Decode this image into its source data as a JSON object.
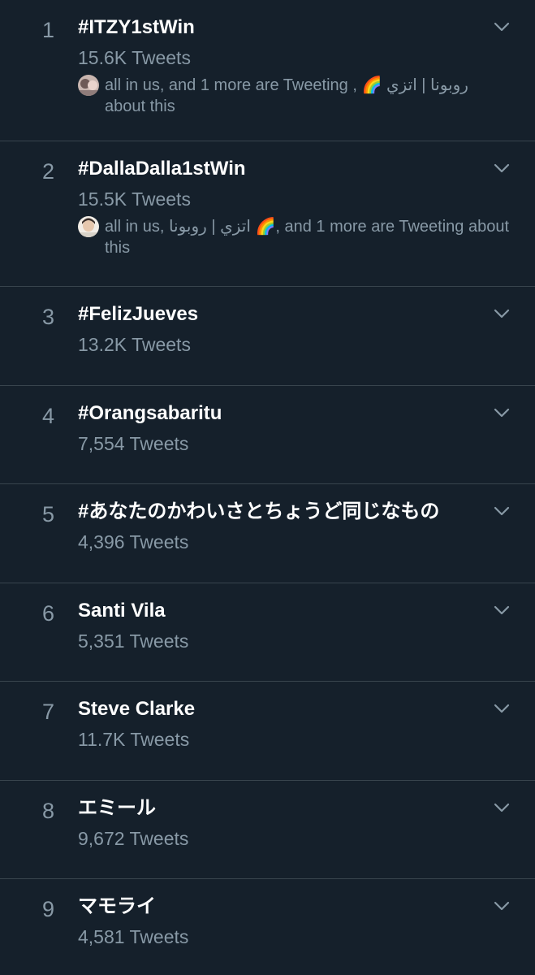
{
  "trends": [
    {
      "rank": "1",
      "title": "#ITZY1stWin",
      "count": "15.6K Tweets",
      "context": "all in us, and 1 more are Tweeting , 🌈 روبونا | اتزي about this"
    },
    {
      "rank": "2",
      "title": "#DallaDalla1stWin",
      "count": "15.5K Tweets",
      "context": "all in us, اتزي | روبونا 🌈, and 1 more are Tweeting about this"
    },
    {
      "rank": "3",
      "title": "#FelizJueves",
      "count": "13.2K Tweets"
    },
    {
      "rank": "4",
      "title": "#Orangsabaritu",
      "count": "7,554 Tweets"
    },
    {
      "rank": "5",
      "title": "#あなたのかわいさとちょうど同じなもの",
      "count": "4,396 Tweets"
    },
    {
      "rank": "6",
      "title": "Santi Vila",
      "count": "5,351 Tweets"
    },
    {
      "rank": "7",
      "title": "Steve Clarke",
      "count": "11.7K Tweets"
    },
    {
      "rank": "8",
      "title": "エミール",
      "count": "9,672 Tweets"
    },
    {
      "rank": "9",
      "title": "マモライ",
      "count": "4,581 Tweets"
    }
  ],
  "icons": {
    "chevron": "chevron-down-icon",
    "avatar": "user-avatar"
  },
  "colors": {
    "background": "#15202b",
    "divider": "#38444d",
    "primary_text": "#ffffff",
    "secondary_text": "#8899a6"
  }
}
